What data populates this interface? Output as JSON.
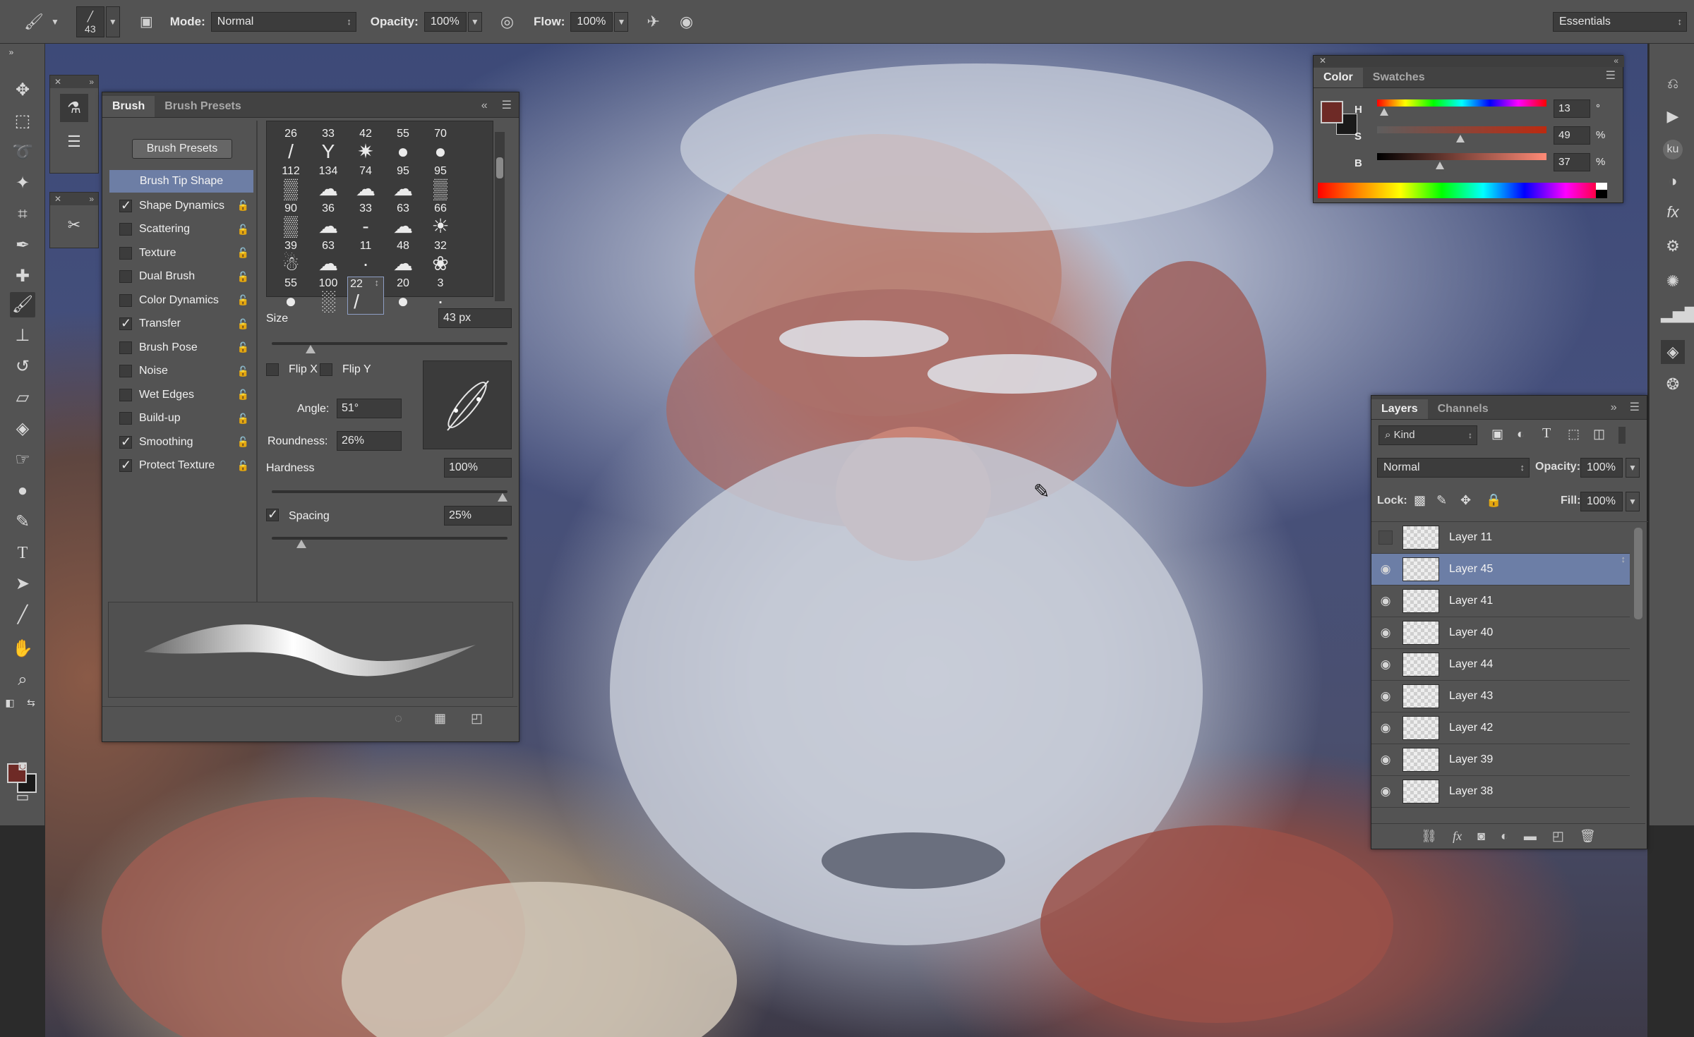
{
  "options_bar": {
    "brush_size": "43",
    "mode_label": "Mode:",
    "mode_value": "Normal",
    "opacity_label": "Opacity:",
    "opacity_value": "100%",
    "flow_label": "Flow:",
    "flow_value": "100%",
    "workspace": "Essentials"
  },
  "brush_panel": {
    "tabs": [
      "Brush",
      "Brush Presets"
    ],
    "presets_button": "Brush Presets",
    "tip_shape": "Brush Tip Shape",
    "options": [
      {
        "label": "Shape Dynamics",
        "checked": true
      },
      {
        "label": "Scattering",
        "checked": false
      },
      {
        "label": "Texture",
        "checked": false
      },
      {
        "label": "Dual Brush",
        "checked": false
      },
      {
        "label": "Color Dynamics",
        "checked": false
      },
      {
        "label": "Transfer",
        "checked": true
      },
      {
        "label": "Brush Pose",
        "checked": false
      },
      {
        "label": "Noise",
        "checked": false
      },
      {
        "label": "Wet Edges",
        "checked": false
      },
      {
        "label": "Build-up",
        "checked": false
      },
      {
        "label": "Smoothing",
        "checked": true
      },
      {
        "label": "Protect Texture",
        "checked": true
      }
    ],
    "tips": [
      {
        "num": "26",
        "glyph": "/"
      },
      {
        "num": "33",
        "glyph": "Y"
      },
      {
        "num": "42",
        "glyph": "✷"
      },
      {
        "num": "55",
        "glyph": "●"
      },
      {
        "num": "70",
        "glyph": "●"
      },
      {
        "num": "112",
        "glyph": "▒"
      },
      {
        "num": "134",
        "glyph": "☁"
      },
      {
        "num": "74",
        "glyph": "☁"
      },
      {
        "num": "95",
        "glyph": "☁"
      },
      {
        "num": "95",
        "glyph": "▒"
      },
      {
        "num": "90",
        "glyph": "▒"
      },
      {
        "num": "36",
        "glyph": "☁"
      },
      {
        "num": "33",
        "glyph": "-"
      },
      {
        "num": "63",
        "glyph": "☁"
      },
      {
        "num": "66",
        "glyph": "☀"
      },
      {
        "num": "39",
        "glyph": "☃"
      },
      {
        "num": "63",
        "glyph": "☁"
      },
      {
        "num": "11",
        "glyph": "·"
      },
      {
        "num": "48",
        "glyph": "☁"
      },
      {
        "num": "32",
        "glyph": "❀"
      },
      {
        "num": "55",
        "glyph": "●"
      },
      {
        "num": "100",
        "glyph": "░"
      },
      {
        "num": "22",
        "glyph": "/"
      },
      {
        "num": "20",
        "glyph": "●"
      },
      {
        "num": "3",
        "glyph": "·"
      }
    ],
    "size_label": "Size",
    "size_value": "43 px",
    "size_level": 0.15,
    "flip_x": "Flip X",
    "flip_y": "Flip Y",
    "angle_label": "Angle:",
    "angle_value": "51°",
    "roundness_label": "Roundness:",
    "roundness_value": "26%",
    "hardness_label": "Hardness",
    "hardness_value": "100%",
    "hardness_level": 1.0,
    "spacing_label": "Spacing",
    "spacing_value": "25%",
    "spacing_level": 0.11
  },
  "color_panel": {
    "tabs": [
      "Color",
      "Swatches"
    ],
    "h_label": "H",
    "h_value": "13",
    "h_unit": "°",
    "h_level": 0.04,
    "s_label": "S",
    "s_value": "49",
    "s_unit": "%",
    "s_level": 0.49,
    "b_label": "B",
    "b_value": "37",
    "b_unit": "%",
    "b_level": 0.37,
    "foreground_color": "#6e2a26"
  },
  "layers_panel": {
    "tabs": [
      "Layers",
      "Channels"
    ],
    "kind_label": "Kind",
    "blend_mode": "Normal",
    "opacity_label": "Opacity:",
    "opacity_value": "100%",
    "lock_label": "Lock:",
    "fill_label": "Fill:",
    "fill_value": "100%",
    "layers": [
      {
        "name": "Layer 11",
        "visible": false,
        "selected": false
      },
      {
        "name": "Layer 45",
        "visible": true,
        "selected": true
      },
      {
        "name": "Layer 41",
        "visible": true,
        "selected": false
      },
      {
        "name": "Layer 40",
        "visible": true,
        "selected": false
      },
      {
        "name": "Layer 44",
        "visible": true,
        "selected": false
      },
      {
        "name": "Layer 43",
        "visible": true,
        "selected": false
      },
      {
        "name": "Layer 42",
        "visible": true,
        "selected": false
      },
      {
        "name": "Layer 39",
        "visible": true,
        "selected": false
      },
      {
        "name": "Layer 38",
        "visible": true,
        "selected": false
      }
    ]
  }
}
